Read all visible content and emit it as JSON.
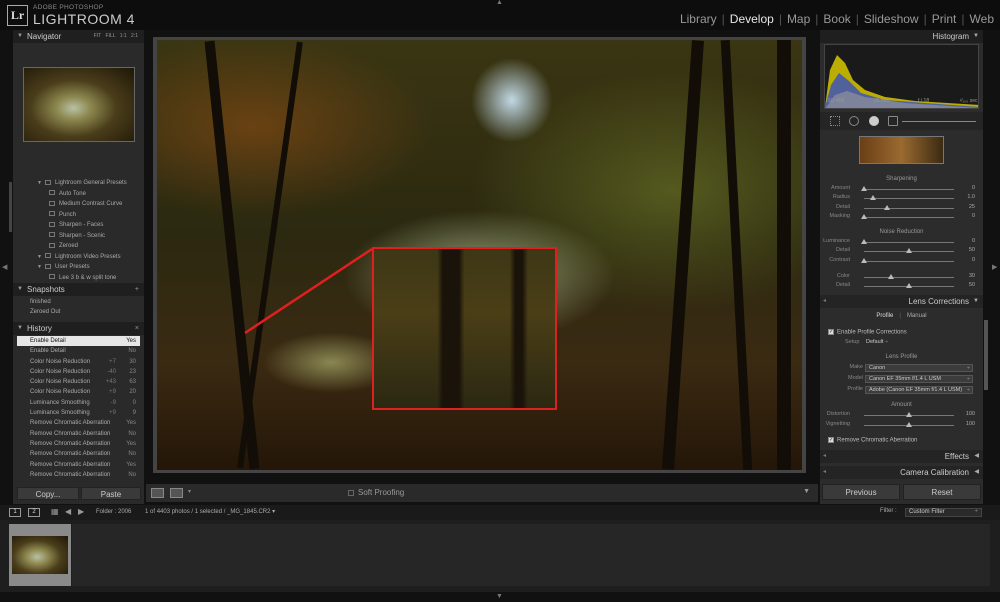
{
  "app": {
    "vendor": "ADOBE PHOTOSHOP",
    "name": "LIGHTROOM 4",
    "logo": "Lr"
  },
  "modules": [
    {
      "label": "Library",
      "active": false
    },
    {
      "label": "Develop",
      "active": true
    },
    {
      "label": "Map",
      "active": false
    },
    {
      "label": "Book",
      "active": false
    },
    {
      "label": "Slideshow",
      "active": false
    },
    {
      "label": "Print",
      "active": false
    },
    {
      "label": "Web",
      "active": false
    }
  ],
  "navigator": {
    "title": "Navigator",
    "options": "FIT FILL 1:1 2:1"
  },
  "presets": [
    {
      "label": "Lightroom General Presets",
      "folder": true
    },
    {
      "label": "Auto Tone",
      "folder": false
    },
    {
      "label": "Medium Contrast Curve",
      "folder": false
    },
    {
      "label": "Punch",
      "folder": false
    },
    {
      "label": "Sharpen - Faces",
      "folder": false
    },
    {
      "label": "Sharpen - Scenic",
      "folder": false
    },
    {
      "label": "Zeroed",
      "folder": false
    },
    {
      "label": "Lightroom Video Presets",
      "folder": true
    },
    {
      "label": "User Presets",
      "folder": true
    },
    {
      "label": "Lee 3 b & w split tone",
      "folder": false
    }
  ],
  "snapshots": {
    "title": "Snapshots",
    "add": "+",
    "items": [
      "finished",
      "Zeroed Out"
    ]
  },
  "history": {
    "title": "History",
    "clear": "×",
    "items": [
      {
        "label": "Enable Detail",
        "from": "",
        "to": "Yes",
        "selected": true
      },
      {
        "label": "Enable Detail",
        "from": "",
        "to": "No",
        "selected": false
      },
      {
        "label": "Color Noise Reduction",
        "from": "+7",
        "to": "30",
        "selected": false
      },
      {
        "label": "Color Noise Reduction",
        "from": "-40",
        "to": "23",
        "selected": false
      },
      {
        "label": "Color Noise Reduction",
        "from": "+43",
        "to": "63",
        "selected": false
      },
      {
        "label": "Color Noise Reduction",
        "from": "+9",
        "to": "20",
        "selected": false
      },
      {
        "label": "Luminance Smoothing",
        "from": "-9",
        "to": "0",
        "selected": false
      },
      {
        "label": "Luminance Smoothing",
        "from": "+9",
        "to": "9",
        "selected": false
      },
      {
        "label": "Remove Chromatic Aberration",
        "from": "",
        "to": "Yes",
        "selected": false
      },
      {
        "label": "Remove Chromatic Aberration",
        "from": "",
        "to": "No",
        "selected": false
      },
      {
        "label": "Remove Chromatic Aberration",
        "from": "",
        "to": "Yes",
        "selected": false
      },
      {
        "label": "Remove Chromatic Aberration",
        "from": "",
        "to": "No",
        "selected": false
      },
      {
        "label": "Remove Chromatic Aberration",
        "from": "",
        "to": "Yes",
        "selected": false
      },
      {
        "label": "Remove Chromatic Aberration",
        "from": "",
        "to": "No",
        "selected": false
      }
    ]
  },
  "left_buttons": {
    "copy": "Copy...",
    "paste": "Paste"
  },
  "toolbar": {
    "soft_proofing": "Soft Proofing"
  },
  "histogram": {
    "title": "Histogram",
    "iso": "ISO 400",
    "focal": "35 mm",
    "aperture": "f / 18",
    "shutter": "¹⁄₁₀₀ sec"
  },
  "detail": {
    "sharpening_title": "Sharpening",
    "sharpening": [
      {
        "label": "Amount",
        "value": "0",
        "pos": 0.0
      },
      {
        "label": "Radius",
        "value": "1.0",
        "pos": 0.1
      },
      {
        "label": "Detail",
        "value": "25",
        "pos": 0.25
      },
      {
        "label": "Masking",
        "value": "0",
        "pos": 0.0
      }
    ],
    "noise_title": "Noise Reduction",
    "noise": [
      {
        "label": "Luminance",
        "value": "0",
        "pos": 0.0
      },
      {
        "label": "Detail",
        "value": "50",
        "pos": 0.5
      },
      {
        "label": "Contrast",
        "value": "0",
        "pos": 0.0
      },
      {
        "label": "Color",
        "value": "30",
        "pos": 0.3
      },
      {
        "label": "Detail",
        "value": "50",
        "pos": 0.5
      }
    ]
  },
  "lens": {
    "title": "Lens Corrections",
    "tabs": [
      "Profile",
      "Manual"
    ],
    "enable_label": "Enable Profile Corrections",
    "setup_label": "Setup",
    "setup_value": "Default",
    "profile_title": "Lens Profile",
    "make_label": "Make",
    "make_value": "Canon",
    "model_label": "Model",
    "model_value": "Canon EF 35mm f/1.4 L USM",
    "profile_label": "Profile",
    "profile_value": "Adobe (Canon EF 35mm f/1.4 L USM)",
    "amount_title": "Amount",
    "amount": [
      {
        "label": "Distortion",
        "value": "100",
        "pos": 0.5
      },
      {
        "label": "Vignetting",
        "value": "100",
        "pos": 0.5
      }
    ],
    "chroma_label": "Remove Chromatic Aberration"
  },
  "sections": {
    "effects": "Effects",
    "calibration": "Camera Calibration"
  },
  "right_buttons": {
    "previous": "Previous",
    "reset": "Reset"
  },
  "filmbar": {
    "screen1": "1",
    "screen2": "2",
    "folder": "Folder : 2006",
    "count": "1 of 4403 photos / 1 selected /",
    "filename": "_MG_1845.CR2",
    "filter_label": "Filter :",
    "filter_value": "Custom Filter"
  },
  "colors": {
    "accent_red": "#e02020",
    "history_selected": "#e6e6e6"
  }
}
